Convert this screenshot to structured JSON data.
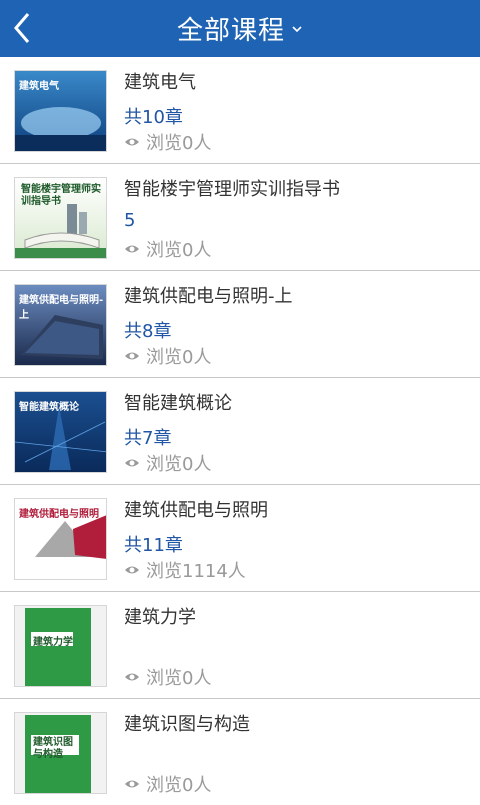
{
  "header": {
    "title": "全部课程",
    "back_icon": "back-chevron-icon",
    "dropdown_icon": "chevron-down-icon",
    "bg": "#1f64b4"
  },
  "courses": [
    {
      "name": "建筑电气",
      "chapters": "共10章",
      "views": "浏览0人",
      "thumb_caption": "建筑电气"
    },
    {
      "name": "智能楼宇管理师实训指导书",
      "chapters": "5",
      "views": "浏览0人",
      "thumb_caption": "智能楼宇管理师实训指导书"
    },
    {
      "name": "建筑供配电与照明-上",
      "chapters": "共8章",
      "views": "浏览0人",
      "thumb_caption": "建筑供配电与照明-上"
    },
    {
      "name": "智能建筑概论",
      "chapters": "共7章",
      "views": "浏览0人",
      "thumb_caption": "智能建筑概论"
    },
    {
      "name": "建筑供配电与照明",
      "chapters": "共11章",
      "views": "浏览1114人",
      "thumb_caption": "建筑供配电与照明"
    },
    {
      "name": "建筑力学",
      "chapters": "",
      "views": "浏览0人",
      "thumb_caption": "建筑力学"
    },
    {
      "name": "建筑识图与构造",
      "chapters": "",
      "views": "浏览0人",
      "thumb_caption": "建筑识图与构造"
    }
  ]
}
